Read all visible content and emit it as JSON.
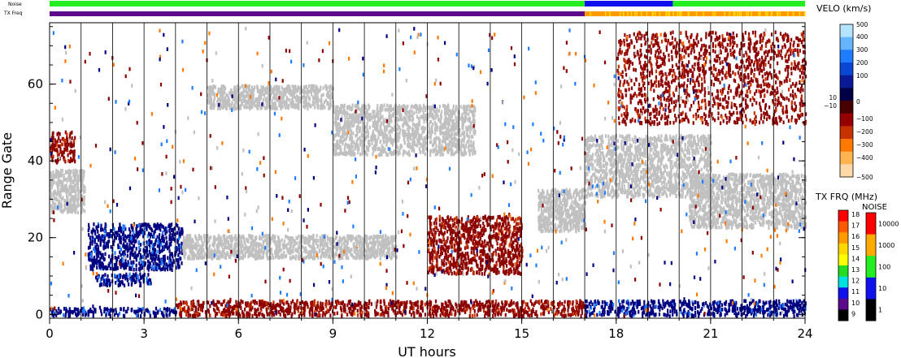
{
  "header": {
    "noise_label": "Noise",
    "txfreq_label": "TX Freq"
  },
  "colors": {
    "noise_green": "#22ee22",
    "noise_blue": "#1010ee",
    "txfreq_purple": "#5a0a8a",
    "txfreq_orange": "#ff9a00",
    "txfreq_yellow": "#ffd800",
    "ground_scatter": "#c0c0c0",
    "dark_red": "#8c0000",
    "dark_blue": "#000080"
  },
  "chart_data": {
    "type": "heatmap",
    "title": "",
    "xlabel": "UT hours",
    "ylabel": "Range Gate",
    "xlim": [
      0,
      24
    ],
    "ylim": [
      -1,
      76
    ],
    "x_ticks": [
      "0",
      "3",
      "6",
      "9",
      "12",
      "15",
      "18",
      "21",
      "24"
    ],
    "y_ticks": [
      "0",
      "20",
      "40",
      "60"
    ],
    "noise_bar": [
      {
        "start": 0,
        "end": 17.0,
        "level": "100"
      },
      {
        "start": 17.0,
        "end": 19.8,
        "level": "10"
      },
      {
        "start": 19.8,
        "end": 24,
        "level": "100"
      }
    ],
    "txfreq_bar": [
      {
        "start": 0,
        "end": 17.0,
        "mhz": 10
      },
      {
        "start": 17.0,
        "end": 24,
        "mhz": 15
      }
    ],
    "scatter_regions": [
      {
        "kind": "ground",
        "t0": 0.0,
        "t1": 1.1,
        "g0": 27,
        "g1": 38
      },
      {
        "kind": "red",
        "t0": 0.0,
        "t1": 0.8,
        "g0": 40,
        "g1": 48
      },
      {
        "kind": "blue",
        "t0": 1.2,
        "t1": 4.2,
        "g0": 12,
        "g1": 24
      },
      {
        "kind": "blue",
        "t0": 1.4,
        "t1": 3.2,
        "g0": 8,
        "g1": 11
      },
      {
        "kind": "ground",
        "t0": 4.2,
        "t1": 11.0,
        "g0": 15,
        "g1": 21
      },
      {
        "kind": "red",
        "t0": 12.0,
        "t1": 15.0,
        "g0": 11,
        "g1": 26
      },
      {
        "kind": "ground",
        "t0": 15.5,
        "t1": 17.0,
        "g0": 22,
        "g1": 33
      },
      {
        "kind": "ground",
        "t0": 17.0,
        "t1": 21.0,
        "g0": 31,
        "g1": 47
      },
      {
        "kind": "ground",
        "t0": 20.3,
        "t1": 24.0,
        "g0": 23,
        "g1": 37
      },
      {
        "kind": "red",
        "t0": 4.0,
        "t1": 17.0,
        "g0": 0,
        "g1": 4
      },
      {
        "kind": "blue",
        "t0": 0.0,
        "t1": 4.0,
        "g0": 0,
        "g1": 2
      },
      {
        "kind": "blue",
        "t0": 17.0,
        "t1": 24.0,
        "g0": 0,
        "g1": 4
      },
      {
        "kind": "ground",
        "t0": 5.0,
        "t1": 9.0,
        "g0": 54,
        "g1": 60
      },
      {
        "kind": "ground",
        "t0": 9.0,
        "t1": 13.5,
        "g0": 42,
        "g1": 55
      },
      {
        "kind": "red",
        "t0": 18.0,
        "t1": 24.0,
        "g0": 50,
        "g1": 74
      }
    ]
  },
  "velocity_scale": {
    "title": "VELO (km/s)",
    "labels": [
      "500",
      "400",
      "300",
      "200",
      "100",
      "10",
      "0",
      "−10",
      "−100",
      "−200",
      "−300",
      "−400",
      "−500"
    ],
    "colors": [
      "#b4e4ff",
      "#64b4ff",
      "#1e7cff",
      "#0a48d4",
      "#0a1a96",
      "#000046",
      "#460000",
      "#960000",
      "#c83200",
      "#ff7800",
      "#ffb450",
      "#ffd8a8"
    ]
  },
  "txfreq_scale": {
    "title": "TX FRQ (MHz)",
    "labels": [
      "18",
      "17",
      "16",
      "15",
      "14",
      "13",
      "12",
      "11",
      "10",
      "9"
    ],
    "colors": [
      "#ff0000",
      "#ff5a00",
      "#ff9a00",
      "#ffd800",
      "#ffff00",
      "#22dd22",
      "#00e0e0",
      "#1010ee",
      "#5a0a8a",
      "#000000"
    ]
  },
  "noise_scale": {
    "title": "NOISE",
    "labels": [
      "10000",
      "1000",
      "100",
      "10",
      "1"
    ],
    "colors": [
      "#ff0000",
      "#ffaa00",
      "#22ee22",
      "#1010ee",
      "#000000"
    ]
  }
}
